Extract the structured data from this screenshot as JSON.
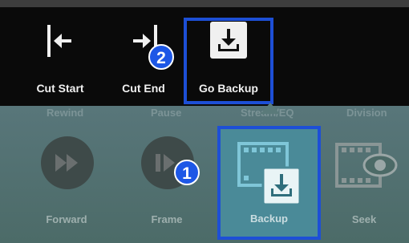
{
  "top_toolbar": {
    "cut_start_label": "Cut Start",
    "cut_end_label": "Cut End",
    "go_backup_label": "Go Backup"
  },
  "bottom_toolbar": {
    "faded_row": [
      "Rewind",
      "Pause",
      "Stream/EQ",
      "Division"
    ],
    "items": [
      {
        "label": "Forward",
        "icon": "fast-forward-icon"
      },
      {
        "label": "Frame",
        "icon": "frame-step-icon"
      },
      {
        "label": "Backup",
        "icon": "backup-icon"
      },
      {
        "label": "Seek",
        "icon": "seek-icon"
      }
    ]
  },
  "badges": {
    "step1": "1",
    "step2": "2"
  },
  "colors": {
    "highlight": "#1d4fd6",
    "badge": "#1d57e6",
    "toolbar_bg": "#0a0a0a",
    "panel_bg": "#4c6a67"
  }
}
